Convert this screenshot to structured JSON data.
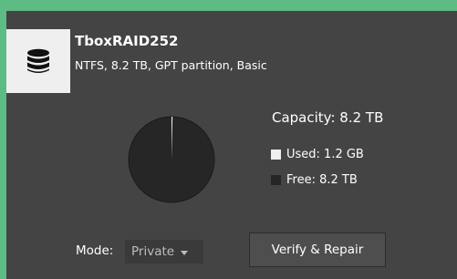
{
  "disk": {
    "icon": "database-icon",
    "name": "TboxRAID252",
    "details": "NTFS, 8.2 TB, GPT partition, Basic"
  },
  "usage": {
    "capacity_text": "Capacity: 8.2 TB",
    "used_text": "Used: 1.2 GB",
    "free_text": "Free: 8.2 TB",
    "used_fraction": 0.00015,
    "used_color": "#efefef",
    "free_color": "#262626"
  },
  "controls": {
    "mode_label": "Mode:",
    "mode_value": "Private",
    "verify_label": "Verify & Repair"
  },
  "colors": {
    "accent": "#5dbb84",
    "panel": "#444444"
  }
}
